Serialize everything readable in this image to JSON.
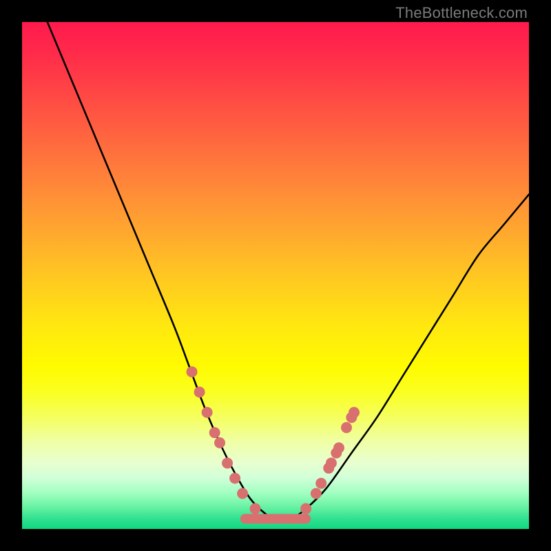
{
  "watermark": "TheBottleneck.com",
  "chart_data": {
    "type": "line",
    "title": "",
    "xlabel": "",
    "ylabel": "",
    "xlim": [
      0,
      100
    ],
    "ylim": [
      0,
      100
    ],
    "grid": false,
    "legend": false,
    "series": [
      {
        "name": "bottleneck-curve",
        "x": [
          5,
          10,
          15,
          20,
          25,
          30,
          33,
          36,
          39,
          42,
          45,
          48,
          50,
          53,
          56,
          60,
          65,
          70,
          75,
          80,
          85,
          90,
          95,
          100
        ],
        "y": [
          100,
          88,
          76,
          64,
          52,
          40,
          32,
          24,
          17,
          11,
          6,
          3,
          2,
          2,
          4,
          8,
          15,
          22,
          30,
          38,
          46,
          54,
          60,
          66
        ]
      }
    ],
    "markers": {
      "name": "data-points",
      "color": "#d87070",
      "points": [
        {
          "x": 33.5,
          "y": 31
        },
        {
          "x": 35.0,
          "y": 27
        },
        {
          "x": 36.5,
          "y": 23
        },
        {
          "x": 38.0,
          "y": 19
        },
        {
          "x": 39.0,
          "y": 17
        },
        {
          "x": 40.5,
          "y": 13
        },
        {
          "x": 42.0,
          "y": 10
        },
        {
          "x": 43.5,
          "y": 7
        },
        {
          "x": 46.0,
          "y": 4
        },
        {
          "x": 56.0,
          "y": 4
        },
        {
          "x": 58.0,
          "y": 7
        },
        {
          "x": 59.0,
          "y": 9
        },
        {
          "x": 60.5,
          "y": 12
        },
        {
          "x": 61.0,
          "y": 13
        },
        {
          "x": 62.0,
          "y": 15
        },
        {
          "x": 62.5,
          "y": 16
        },
        {
          "x": 64.0,
          "y": 20
        },
        {
          "x": 65.0,
          "y": 22
        },
        {
          "x": 65.5,
          "y": 23
        }
      ]
    },
    "flat_segment": {
      "name": "optimal-band",
      "color": "#d87070",
      "x_start": 44,
      "x_end": 56,
      "y": 2
    },
    "background_gradient": {
      "top": "#ff1a4d",
      "mid": "#ffe810",
      "bottom": "#10d880"
    }
  }
}
